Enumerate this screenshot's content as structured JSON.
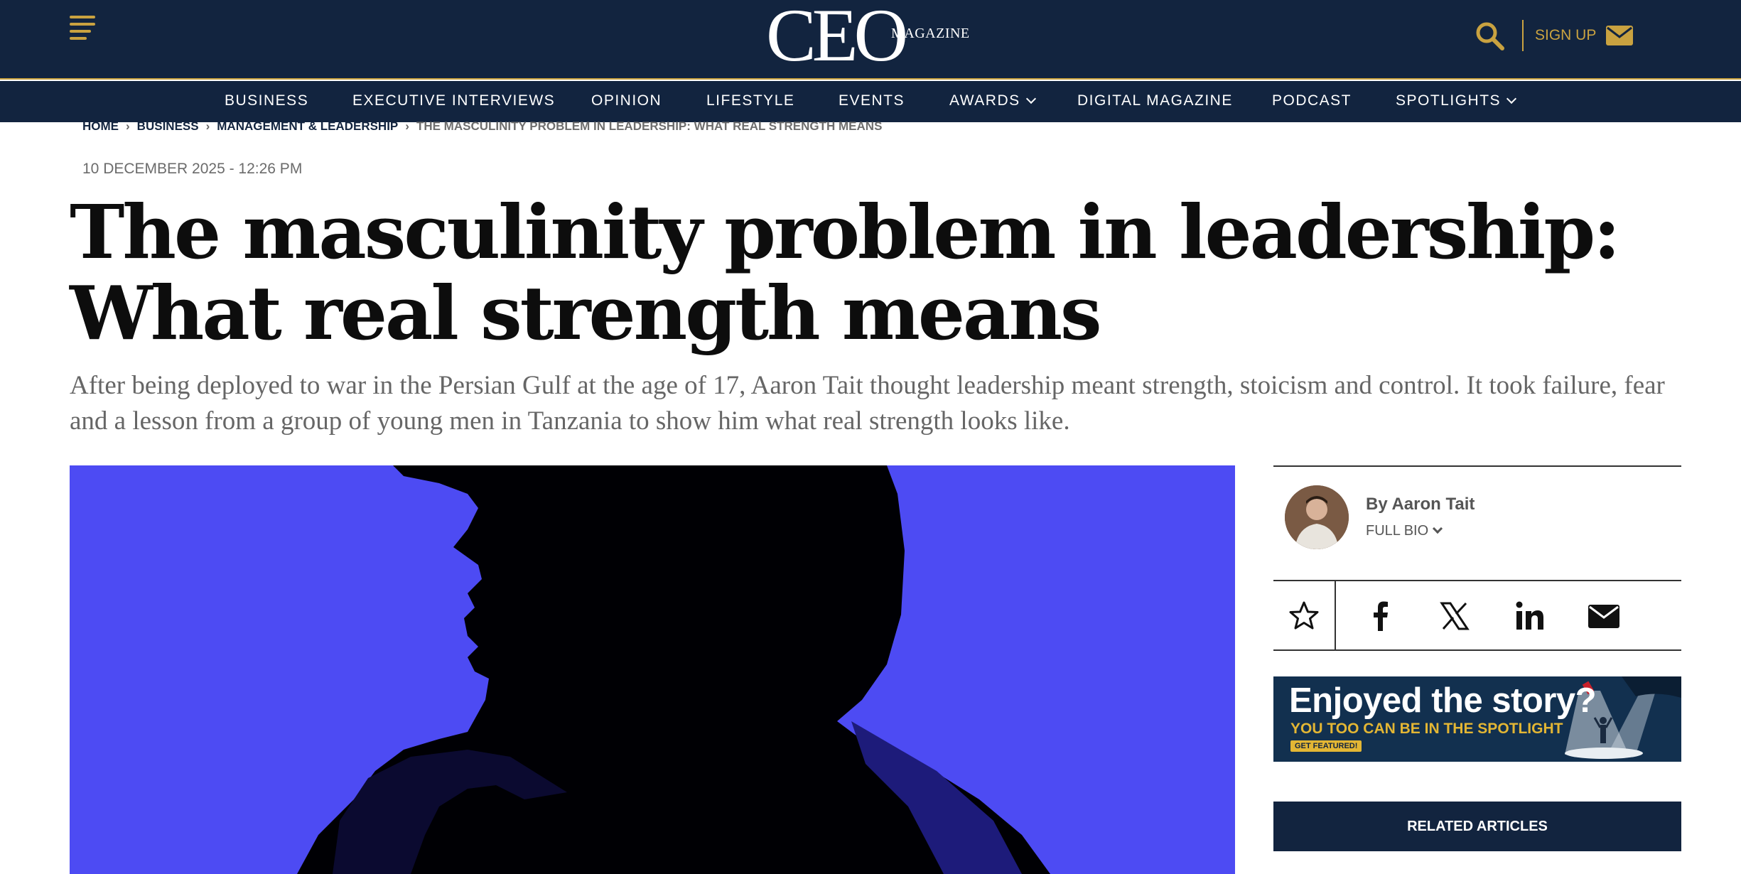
{
  "header": {
    "logo_main": "CEO",
    "logo_sub": "MAGAZINE",
    "signup_label": "SIGN UP",
    "accent_color": "#c9a240",
    "background_color": "#12243f"
  },
  "nav": {
    "items": [
      {
        "label": "BUSINESS"
      },
      {
        "label": "EXECUTIVE INTERVIEWS"
      },
      {
        "label": "OPINION"
      },
      {
        "label": "LIFESTYLE"
      },
      {
        "label": "EVENTS"
      },
      {
        "label": "AWARDS"
      },
      {
        "label": "DIGITAL MAGAZINE"
      },
      {
        "label": "PODCAST"
      },
      {
        "label": "SPOTLIGHTS"
      }
    ]
  },
  "breadcrumb": {
    "items": [
      "HOME",
      "BUSINESS",
      "MANAGEMENT & LEADERSHIP"
    ],
    "current": "THE MASCULINITY PROBLEM IN LEADERSHIP: WHAT REAL STRENGTH MEANS"
  },
  "article": {
    "date": "10 DECEMBER 2025 - 12:26 PM",
    "headline": "The masculinity problem in leadership: What real strength means",
    "standfirst": "After being deployed to war in the Persian Gulf at the age of 17, Aaron Tait thought leadership meant strength, stoicism and control. It took failure, fear and a lesson from a group of young men in Tanzania to show him what real strength looks like.",
    "hero_color": "#4d4bf3"
  },
  "sidebar": {
    "author_byline": "By Aaron Tait",
    "full_bio_label": "FULL BIO",
    "share_icons": [
      "star-icon",
      "facebook-icon",
      "x-icon",
      "linkedin-icon",
      "email-icon"
    ],
    "promo": {
      "title": "Enjoyed the story?",
      "subtitle": "YOU TOO CAN BE IN THE SPOTLIGHT",
      "button": "GET FEATURED!"
    },
    "related_label": "RELATED ARTICLES"
  }
}
